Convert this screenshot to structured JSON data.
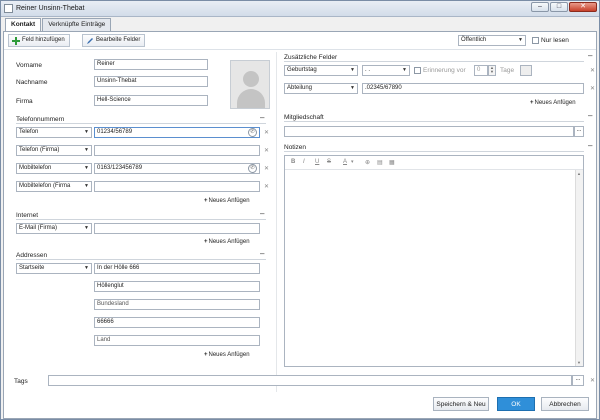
{
  "window": {
    "title": "Reiner Unsinn-Thebat"
  },
  "tabs": [
    {
      "label": "Kontakt"
    },
    {
      "label": "Verknüpfte Einträge"
    }
  ],
  "toolbar": {
    "add_field_label": "Feld hinzufügen",
    "edit_fields_label": "Bearbeite Felder",
    "visibility_value": "Öffentlich",
    "read_only_label": "Nur lesen"
  },
  "person": {
    "first_name_label": "Vorname",
    "first_name": "Reiner",
    "last_name_label": "Nachname",
    "last_name": "Unsinn-Thebat",
    "company_label": "Firma",
    "company": "Hell-Science"
  },
  "phones": {
    "section_label": "Telefonnummern",
    "rows": [
      {
        "type": "Telefon",
        "value": "01234/56789"
      },
      {
        "type": "Telefon (Firma)",
        "value": ""
      },
      {
        "type": "Mobiltelefon",
        "value": "0163/123456789"
      },
      {
        "type": "Mobiltelefon (Firma",
        "value": ""
      }
    ],
    "add_label": "Neues Anfügen"
  },
  "internet": {
    "section_label": "Internet",
    "type": "E-Mail (Firma)",
    "value": "",
    "add_label": "Neues Anfügen"
  },
  "addresses": {
    "section_label": "Addressen",
    "type": "Startseite",
    "street": "In der Hölle 666",
    "city": "Höllenglut",
    "state": "Bundesland",
    "zip": "66666",
    "country": "Land",
    "add_label": "Neues Anfügen"
  },
  "extra": {
    "section_label": "Zusätzliche Felder",
    "birthday_type": "Geburtstag",
    "birthday_value": ". .",
    "reminder_label": "Erinnerung vor",
    "reminder_value": "0",
    "days_label": "Tage",
    "dept_type": "Abteilung",
    "dept_value": ".02345/67890",
    "add_label": "Neues Anfügen"
  },
  "membership": {
    "section_label": "Mitgliedschaft",
    "value": "",
    "browse": "..."
  },
  "notes": {
    "section_label": "Notizen",
    "tools": [
      "B",
      "I",
      "U",
      "S",
      "A",
      "▾",
      "⊕",
      "▤",
      "▦"
    ]
  },
  "tags": {
    "label": "Tags",
    "value": "",
    "browse": "..."
  },
  "footer": {
    "save_new_label": "Speichern & Neu",
    "ok_label": "OK",
    "cancel_label": "Abbrechen"
  }
}
